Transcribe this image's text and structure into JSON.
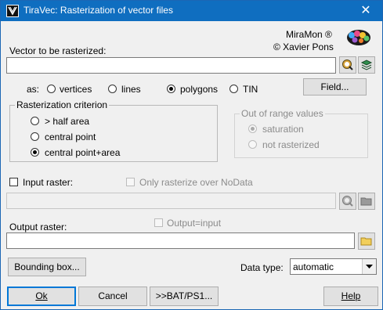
{
  "window": {
    "title": "TiraVec: Rasterization of vector files",
    "close_glyph": "✕"
  },
  "branding": {
    "line1": "MiraMon ®",
    "line2": "© Xavier Pons",
    "logo_icon": "miramon-logo-icon"
  },
  "vector": {
    "label": "Vector to be rasterized:",
    "value": ""
  },
  "as": {
    "label": "as:",
    "options": [
      {
        "label": "vertices",
        "checked": false
      },
      {
        "label": "lines",
        "checked": false
      },
      {
        "label": "polygons",
        "checked": true
      },
      {
        "label": "TIN",
        "checked": false
      }
    ],
    "field_button": "Field..."
  },
  "criterion": {
    "title": "Rasterization criterion",
    "options": [
      {
        "label": "> half area",
        "checked": false
      },
      {
        "label": "central point",
        "checked": false
      },
      {
        "label": "central point+area",
        "checked": true
      }
    ]
  },
  "out_of_range": {
    "title": "Out of range values",
    "options": [
      {
        "label": "saturation",
        "checked": true
      },
      {
        "label": "not rasterized",
        "checked": false
      }
    ]
  },
  "input_raster": {
    "label": "Input raster:",
    "only_nodata_label": "Only rasterize over NoData",
    "value": ""
  },
  "output_raster": {
    "label": "Output raster:",
    "output_equals_input": "Output=input",
    "value": ""
  },
  "bounding_box_button": "Bounding box...",
  "data_type": {
    "label": "Data type:",
    "value": "automatic"
  },
  "buttons": {
    "ok": "Ok",
    "cancel": "Cancel",
    "bat": ">>BAT/PS1...",
    "help": "Help"
  },
  "colors": {
    "titlebar": "#0f6ec0",
    "focus": "#0078d7"
  }
}
